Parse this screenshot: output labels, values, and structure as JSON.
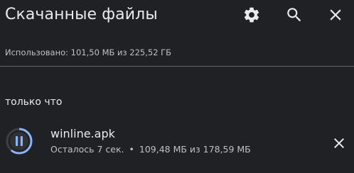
{
  "header": {
    "title": "Скачанные файлы",
    "icons": [
      "gear-icon",
      "search-icon",
      "close-icon"
    ]
  },
  "storage": {
    "usage_text": "Использовано: 101,50 МБ из 225,52 ГБ"
  },
  "section": {
    "label": "только что"
  },
  "downloads": [
    {
      "file_name": "winline.apk",
      "time_left": "Осталось 7 сек.",
      "separator": "•",
      "size_progress": "109,48 МБ из 178,59 МБ",
      "progress_fraction": 0.613,
      "state": "paused-control",
      "icons": [
        "pause-icon",
        "close-icon"
      ]
    }
  ],
  "colors": {
    "background": "#202124",
    "text_primary": "#e8eaed",
    "text_secondary": "#bdc1c6",
    "progress": "#8ab4f8",
    "track": "#3c4043"
  }
}
